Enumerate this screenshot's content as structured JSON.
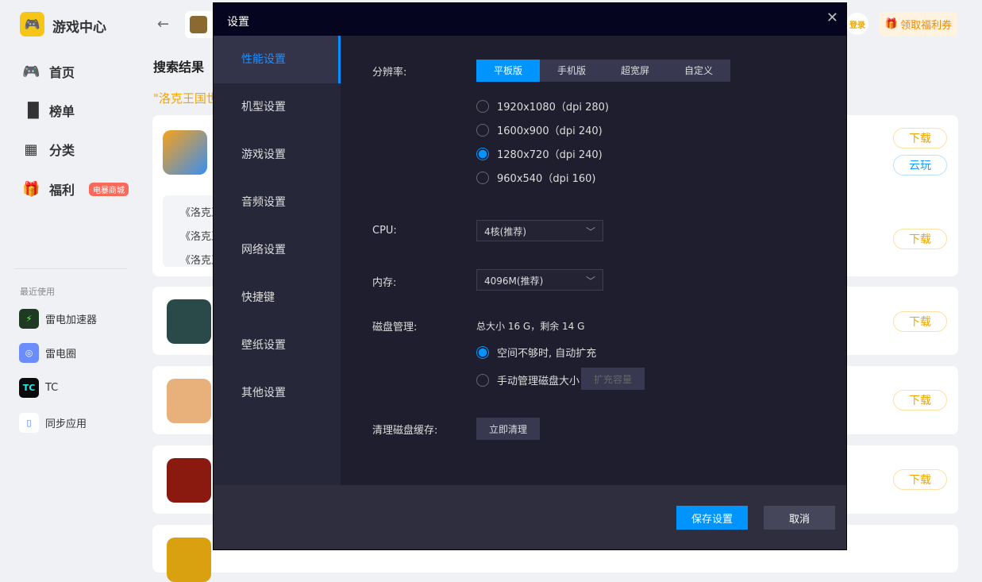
{
  "app": {
    "title": "游戏中心",
    "login": "登录",
    "coupon": "领取福利券"
  },
  "sidebar": {
    "items": [
      {
        "label": "首页",
        "icon": "gamepad-icon"
      },
      {
        "label": "榜单",
        "icon": "chart-icon"
      },
      {
        "label": "分类",
        "icon": "grid-icon"
      },
      {
        "label": "福利",
        "icon": "gift-icon",
        "badge": "电暴商城"
      }
    ],
    "recent_header": "最近使用",
    "recent": [
      {
        "label": "雷电加速器",
        "color": "#1f3a22"
      },
      {
        "label": "雷电圈",
        "color": "#6a8cff"
      },
      {
        "label": "TC",
        "color": "#0a0a0a"
      },
      {
        "label": "同步应用",
        "color": "#ffffff"
      }
    ]
  },
  "main": {
    "title": "搜索结果",
    "query": "\"洛克王国世",
    "sub_items": [
      "《洛克王",
      "《洛克王",
      "《洛克王"
    ],
    "download": "下载",
    "cloud": "云玩"
  },
  "modal": {
    "title": "设置",
    "nav": [
      "性能设置",
      "机型设置",
      "游戏设置",
      "音频设置",
      "网络设置",
      "快捷键",
      "壁纸设置",
      "其他设置"
    ],
    "resolution_label": "分辨率:",
    "resolution_tabs": [
      "平板版",
      "手机版",
      "超宽屏",
      "自定义"
    ],
    "resolutions": [
      "1920x1080（dpi 280)",
      "1600x900（dpi 240)",
      "1280x720（dpi 240)",
      "960x540（dpi 160)"
    ],
    "cpu_label": "CPU:",
    "cpu_value": "4核(推荐)",
    "memory_label": "内存:",
    "memory_value": "4096M(推荐)",
    "disk_label": "磁盘管理:",
    "disk_info": "总大小 16 G，剩余 14 G",
    "disk_auto": "空间不够时, 自动扩充",
    "disk_manual": "手动管理磁盘大小",
    "expand": "扩充容量",
    "cache_label": "清理磁盘缓存:",
    "clean": "立即清理",
    "save": "保存设置",
    "cancel": "取消"
  },
  "colors": {
    "accent": "#0094ff",
    "download": "#f0a500"
  }
}
